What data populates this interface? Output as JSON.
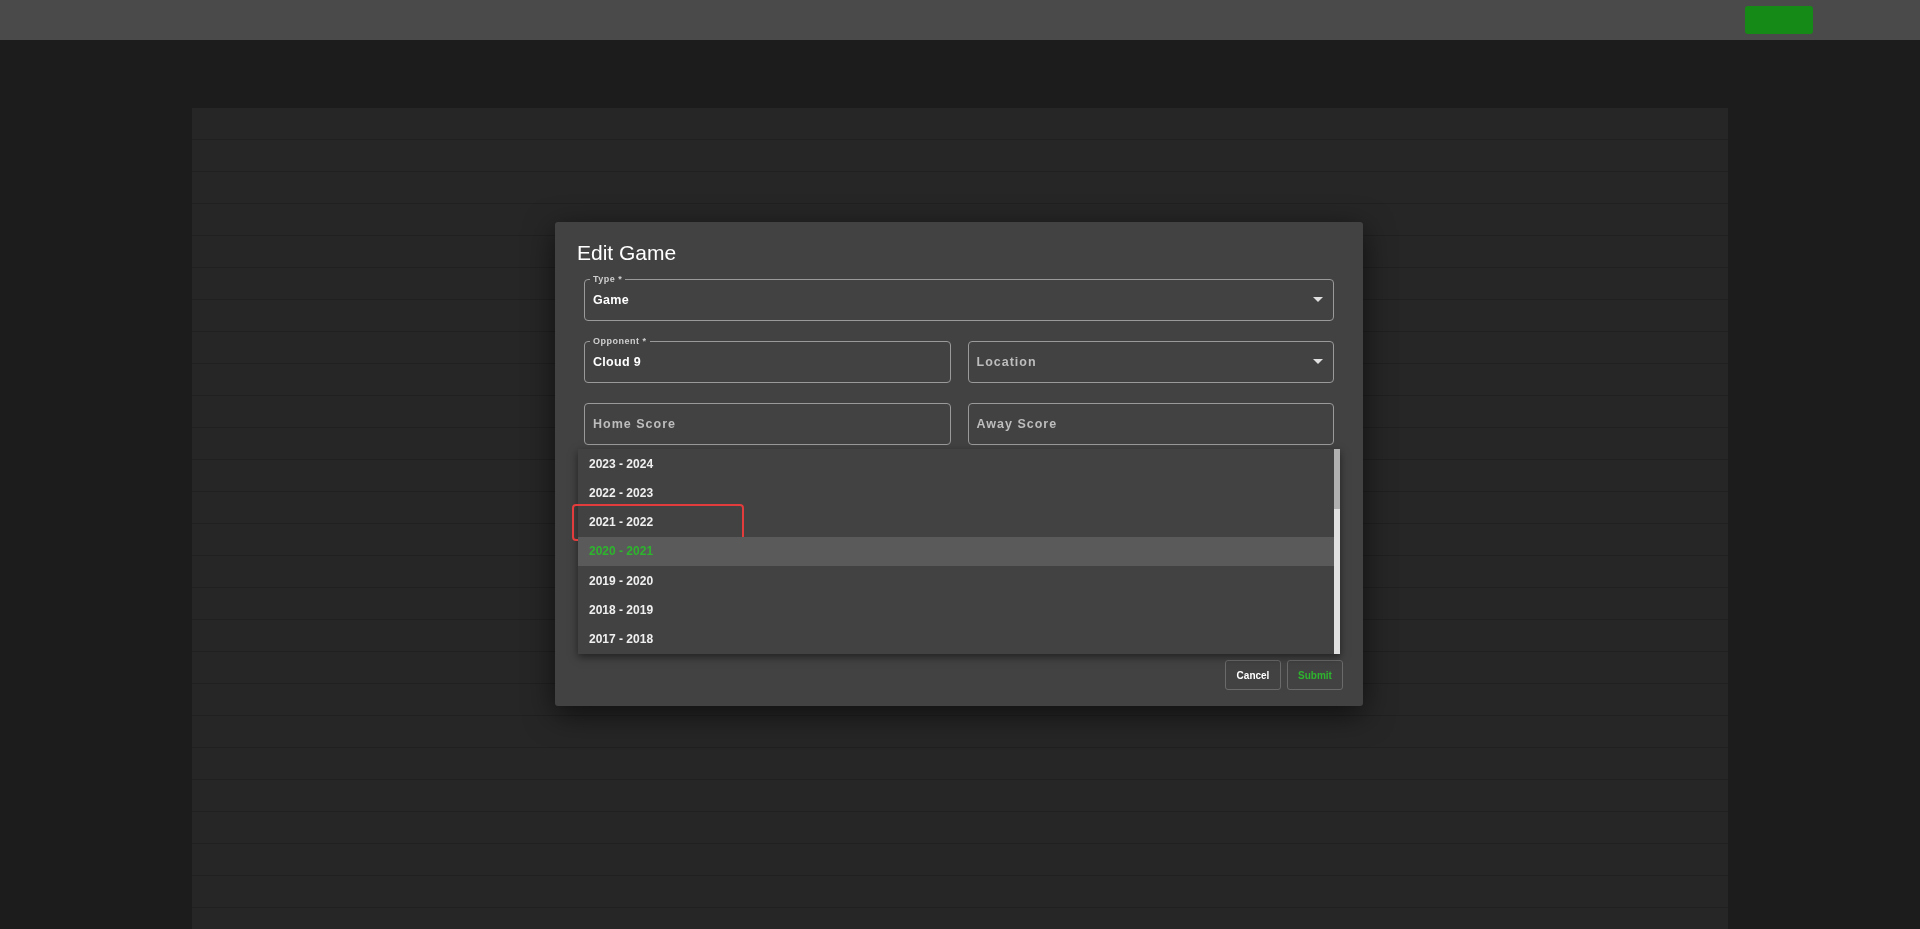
{
  "dialog": {
    "title": "Edit Game",
    "fields": [
      {
        "kind": "select",
        "label": "Type *",
        "value": "Game"
      },
      {
        "kind": "text",
        "label": "Opponent *",
        "value": "Cloud 9"
      },
      {
        "kind": "select",
        "placeholder": "Location"
      },
      {
        "kind": "text",
        "placeholder": "Home Score"
      },
      {
        "kind": "text",
        "placeholder": "Away Score"
      }
    ],
    "season_options": [
      {
        "label": "2023 - 2024",
        "selected": false,
        "highlighted": false
      },
      {
        "label": "2022 - 2023",
        "selected": false,
        "highlighted": false
      },
      {
        "label": "2021 - 2022",
        "selected": false,
        "highlighted": true
      },
      {
        "label": "2020 - 2021",
        "selected": true,
        "highlighted": false
      },
      {
        "label": "2019 - 2020",
        "selected": false,
        "highlighted": false
      },
      {
        "label": "2018 - 2019",
        "selected": false,
        "highlighted": false
      },
      {
        "label": "2017 - 2018",
        "selected": false,
        "highlighted": false
      }
    ],
    "buttons": [
      {
        "kind": "cancel",
        "label": "Cancel"
      },
      {
        "kind": "submit",
        "label": "Submit"
      }
    ]
  }
}
